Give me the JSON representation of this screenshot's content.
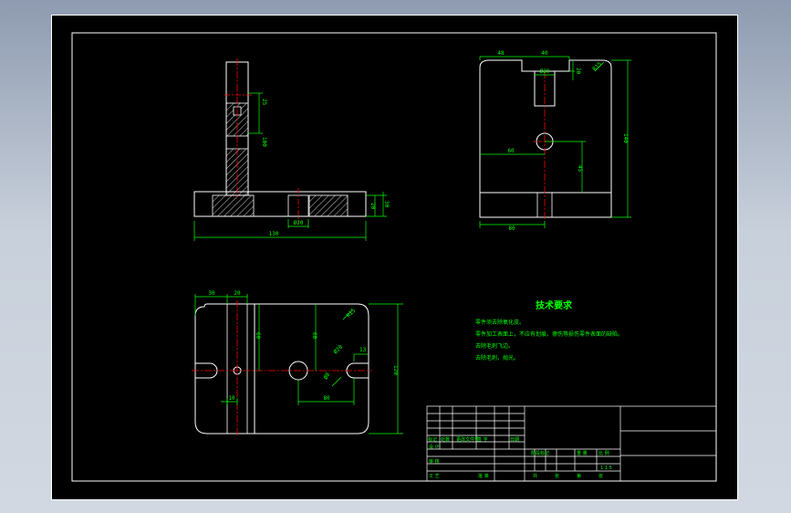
{
  "colors": {
    "drawing_line": "#ffffff",
    "dimension": "#00ff00",
    "center_line": "#ff0000",
    "hatch": "#ffffff",
    "notes_text": "#00ff00",
    "title_text": "#00ff00",
    "table_line": "#ffffff"
  },
  "front_view": {
    "dims": {
      "height_top": "25",
      "height_mid": "100",
      "bottom_total": "130",
      "bore": "Ø20",
      "step_a": "20",
      "step_b": "30"
    }
  },
  "side_view": {
    "dims": {
      "top_left": "48",
      "top_mid": "40",
      "slot": "Ø20",
      "slot_r": "20",
      "corner": "R15",
      "hole_to_left": "60",
      "hole_height": "45",
      "overall_height": "140",
      "base_width": "80"
    }
  },
  "top_view": {
    "dims": {
      "left_a": "30",
      "left_b": "20",
      "mid_height": "60",
      "mid_height2": "60",
      "corner": "R15",
      "hole": "Ø20",
      "slot_w": "13",
      "small_hole": "Ø8",
      "bottom_left": "10",
      "bottom_mid": "80",
      "overall_height": "120"
    }
  },
  "notes": {
    "title": "技术要求",
    "lines": [
      "零件须去除氧化皮。",
      "零件加工表面上，不应有划痕、擦伤等损伤零件表面的缺陷。",
      "去除毛刺飞边。",
      "去除毛刺，抛光。"
    ]
  },
  "title_block": {
    "cells": {
      "biaoji": "标记",
      "chushu": "处数",
      "fenqu": "更改文件号",
      "qianming": "签 字",
      "riqi": "日期",
      "sheji": "设 计",
      "shenhe": "审 核",
      "gongyi": "工 艺",
      "pizhun": "批 准",
      "jieduan": "阶段标记",
      "zhongliang": "重 量",
      "bili": "比 例",
      "scale": "1:1.5",
      "gong": "共",
      "zhang": "张",
      "di": "第",
      "zhang2": "张"
    }
  }
}
